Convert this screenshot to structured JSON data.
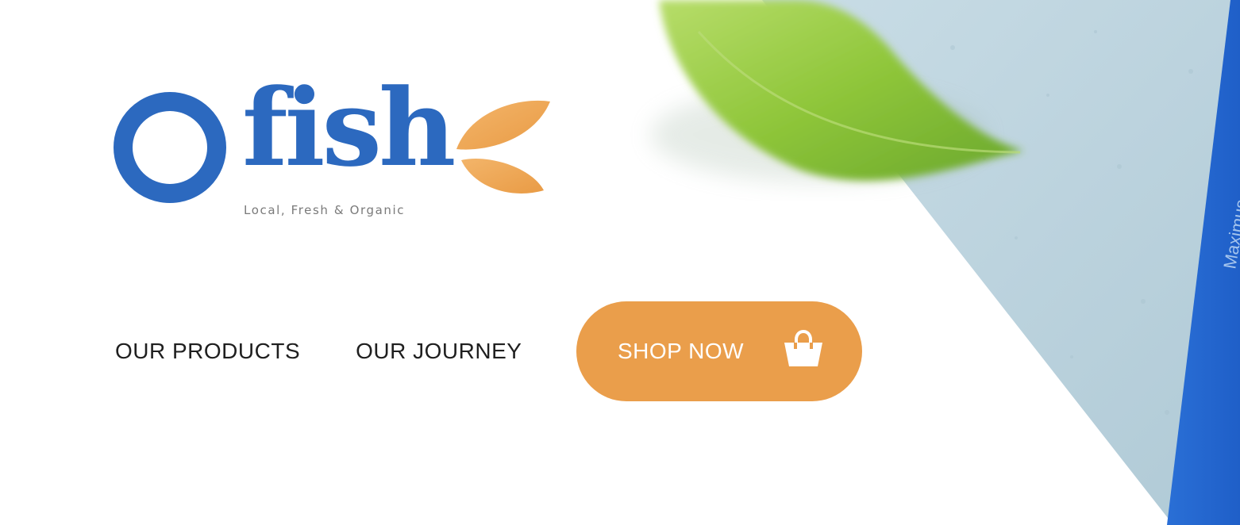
{
  "brand": {
    "name_initial": "O",
    "name_word": "fish",
    "tagline": "Local, Fresh & Organic",
    "primary_color": "#2c69bf",
    "accent_color": "#ea9e4b"
  },
  "nav": {
    "items": [
      {
        "label": "OUR PRODUCTS"
      },
      {
        "label": "OUR JOURNEY"
      }
    ],
    "cta": {
      "label": "SHOP NOW",
      "icon": "shopping-basket-icon"
    }
  },
  "hero_image": {
    "board_text": "Maximus"
  }
}
